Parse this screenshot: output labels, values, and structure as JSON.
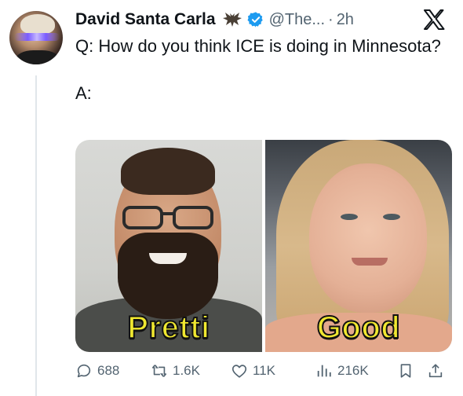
{
  "post": {
    "author_name": "David Santa Carla",
    "handle": "@The...",
    "separator": "·",
    "time": "2h",
    "question": "Q: How do you think ICE is doing in Minnesota?",
    "answer": "A:",
    "media": {
      "left_caption": "Pretti",
      "right_caption": "Good"
    }
  },
  "actions": {
    "replies": "688",
    "reposts": "1.6K",
    "likes": "11K",
    "views": "216K"
  },
  "icons": {
    "author_emoji": "bat-icon",
    "verified": "verified-badge-icon",
    "brand": "x-logo-icon",
    "reply": "reply-icon",
    "repost": "repost-icon",
    "like": "heart-icon",
    "views": "views-icon",
    "bookmark": "bookmark-icon",
    "share": "share-icon"
  },
  "colors": {
    "verified_blue": "#1d9bf0",
    "muted_text": "#536471",
    "caption_yellow": "#f0e830"
  }
}
